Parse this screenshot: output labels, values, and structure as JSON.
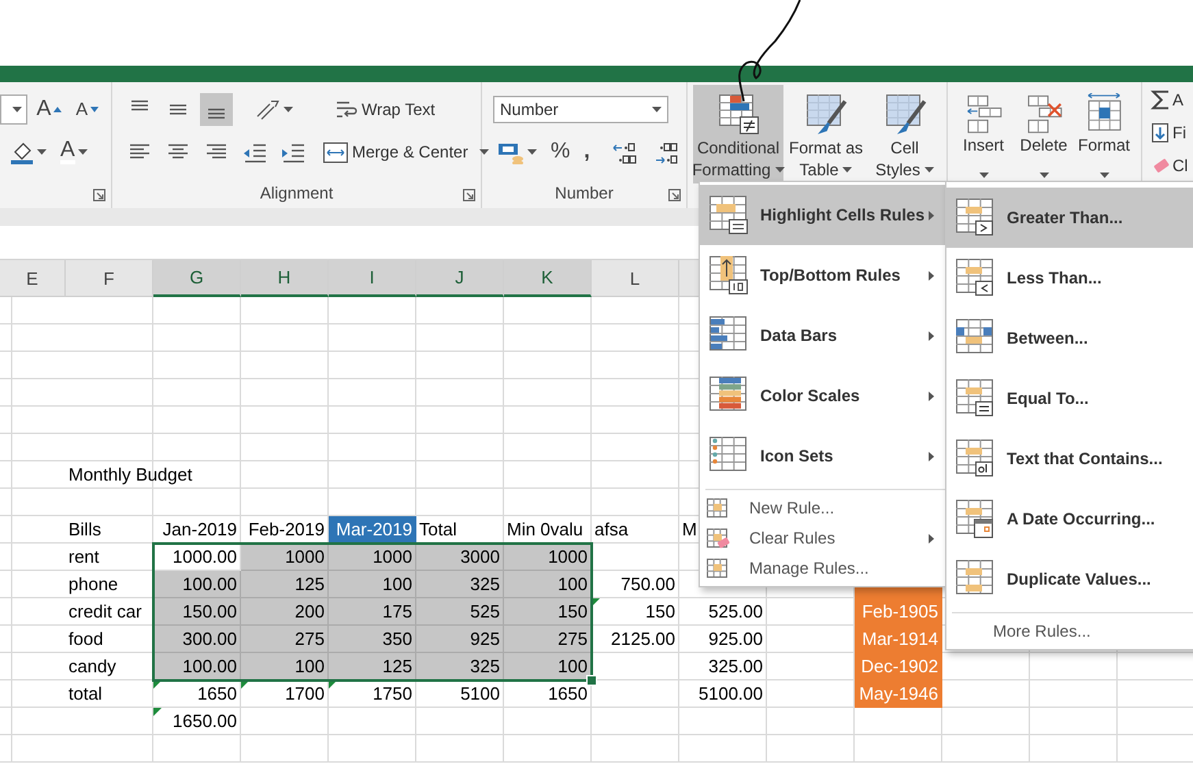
{
  "ribbon": {
    "font": {
      "grow_font": "A",
      "shrink_font": "A",
      "font_color": "A"
    },
    "alignment": {
      "label": "Alignment",
      "vertical": [
        {
          "selected": false
        },
        {
          "selected": false
        },
        {
          "selected": true
        }
      ],
      "wrap_text": "Wrap Text",
      "merge_center": "Merge & Center"
    },
    "number": {
      "label": "Number",
      "format": "Number",
      "percent": "%",
      "comma": ","
    },
    "styles": [
      {
        "lines": [
          "Conditional",
          "Formatting"
        ],
        "selected": true
      },
      {
        "lines": [
          "Format as",
          "Table"
        ],
        "selected": false
      },
      {
        "lines": [
          "Cell",
          "Styles"
        ],
        "selected": false
      }
    ],
    "cells": [
      {
        "label": "Insert"
      },
      {
        "label": "Delete"
      },
      {
        "label": "Format"
      }
    ],
    "editing": [
      {
        "label": "A"
      },
      {
        "label": "Fi"
      },
      {
        "label": "Cl"
      }
    ]
  },
  "sheet": {
    "columns": [
      {
        "label": "E",
        "selected": false
      },
      {
        "label": "F",
        "selected": false
      },
      {
        "label": "G",
        "selected": true
      },
      {
        "label": "H",
        "selected": true
      },
      {
        "label": "I",
        "selected": true
      },
      {
        "label": "J",
        "selected": true
      },
      {
        "label": "K",
        "selected": true
      },
      {
        "label": "L",
        "selected": false
      }
    ],
    "rows": [
      [
        null,
        null,
        null,
        null,
        null,
        null,
        null,
        null,
        null,
        null,
        null,
        null
      ],
      [
        null,
        null,
        null,
        null,
        null,
        null,
        null,
        null,
        null,
        null,
        null,
        null
      ],
      [
        null,
        null,
        null,
        null,
        null,
        null,
        null,
        null,
        null,
        null,
        null,
        null
      ],
      [
        null,
        null,
        null,
        null,
        null,
        null,
        null,
        null,
        null,
        null,
        null,
        null
      ],
      [
        null,
        null,
        null,
        null,
        null,
        null,
        null,
        null,
        null,
        null,
        null,
        null
      ],
      [
        null,
        null,
        null,
        null,
        null,
        null,
        null,
        null,
        null,
        null,
        null,
        null
      ],
      [
        null,
        {
          "text": "Monthly Budget",
          "kind": "label",
          "selected": false,
          "flagged": false
        },
        null,
        null,
        null,
        null,
        null,
        null,
        null,
        null,
        null,
        null
      ],
      [
        null,
        null,
        null,
        null,
        null,
        null,
        null,
        null,
        null,
        null,
        null,
        null
      ],
      [
        null,
        {
          "text": "Bills",
          "kind": "label",
          "selected": false,
          "flagged": false
        },
        {
          "text": "Jan-2019",
          "kind": "value",
          "selected": false,
          "flagged": false
        },
        {
          "text": "Feb-2019",
          "kind": "value",
          "selected": false,
          "flagged": false
        },
        {
          "text": "Mar-2019",
          "kind": "value",
          "selected": false,
          "flagged": false,
          "color": "#2e75b6"
        },
        {
          "text": "Total",
          "kind": "label",
          "selected": false,
          "flagged": false
        },
        {
          "text": "Min 0valu",
          "kind": "label",
          "selected": false,
          "flagged": false
        },
        {
          "text": "afsa",
          "kind": "label",
          "selected": false,
          "flagged": false
        },
        {
          "text": "M",
          "kind": "label",
          "selected": false,
          "flagged": false
        },
        null,
        null,
        null
      ],
      [
        null,
        {
          "text": "rent",
          "kind": "label",
          "selected": false,
          "flagged": false
        },
        {
          "text": "1000.00",
          "kind": "value",
          "selected": false,
          "flagged": false
        },
        {
          "text": "1000",
          "kind": "value",
          "selected": true,
          "flagged": false
        },
        {
          "text": "1000",
          "kind": "value",
          "selected": true,
          "flagged": false
        },
        {
          "text": "3000",
          "kind": "value",
          "selected": true,
          "flagged": false
        },
        {
          "text": "1000",
          "kind": "value",
          "selected": true,
          "flagged": false
        },
        null,
        null,
        null,
        null,
        null
      ],
      [
        null,
        {
          "text": "phone",
          "kind": "label",
          "selected": false,
          "flagged": false
        },
        {
          "text": "100.00",
          "kind": "value",
          "selected": true,
          "flagged": false
        },
        {
          "text": "125",
          "kind": "value",
          "selected": true,
          "flagged": false
        },
        {
          "text": "100",
          "kind": "value",
          "selected": true,
          "flagged": false
        },
        {
          "text": "325",
          "kind": "value",
          "selected": true,
          "flagged": false
        },
        {
          "text": "100",
          "kind": "value",
          "selected": true,
          "flagged": false
        },
        {
          "text": "750.00",
          "kind": "value",
          "selected": false,
          "flagged": false
        },
        null,
        null,
        {
          "kind": "value",
          "selected": false,
          "flagged": false,
          "color": "#ed7d31"
        },
        null
      ],
      [
        null,
        {
          "text": "credit car",
          "kind": "label",
          "selected": false,
          "flagged": false
        },
        {
          "text": "150.00",
          "kind": "value",
          "selected": true,
          "flagged": false
        },
        {
          "text": "200",
          "kind": "value",
          "selected": true,
          "flagged": false
        },
        {
          "text": "175",
          "kind": "value",
          "selected": true,
          "flagged": false
        },
        {
          "text": "525",
          "kind": "value",
          "selected": true,
          "flagged": false
        },
        {
          "text": "150",
          "kind": "value",
          "selected": true,
          "flagged": false
        },
        {
          "text": "150",
          "kind": "value",
          "selected": false,
          "flagged": true
        },
        {
          "text": "525.00",
          "kind": "value",
          "selected": false,
          "flagged": false
        },
        null,
        {
          "text": "Feb-1905",
          "kind": "value",
          "selected": false,
          "flagged": false,
          "color": "#ed7d31"
        },
        null
      ],
      [
        null,
        {
          "text": "food",
          "kind": "label",
          "selected": false,
          "flagged": false
        },
        {
          "text": "300.00",
          "kind": "value",
          "selected": true,
          "flagged": false
        },
        {
          "text": "275",
          "kind": "value",
          "selected": true,
          "flagged": false
        },
        {
          "text": "350",
          "kind": "value",
          "selected": true,
          "flagged": false
        },
        {
          "text": "925",
          "kind": "value",
          "selected": true,
          "flagged": false
        },
        {
          "text": "275",
          "kind": "value",
          "selected": true,
          "flagged": false
        },
        {
          "text": "2125.00",
          "kind": "value",
          "selected": false,
          "flagged": false
        },
        {
          "text": "925.00",
          "kind": "value",
          "selected": false,
          "flagged": false
        },
        null,
        {
          "text": "Mar-1914",
          "kind": "value",
          "selected": false,
          "flagged": false,
          "color": "#ed7d31"
        },
        null
      ],
      [
        null,
        {
          "text": "candy",
          "kind": "label",
          "selected": false,
          "flagged": false
        },
        {
          "text": "100.00",
          "kind": "value",
          "selected": true,
          "flagged": false
        },
        {
          "text": "100",
          "kind": "value",
          "selected": true,
          "flagged": false
        },
        {
          "text": "125",
          "kind": "value",
          "selected": true,
          "flagged": false
        },
        {
          "text": "325",
          "kind": "value",
          "selected": true,
          "flagged": false
        },
        {
          "text": "100",
          "kind": "value",
          "selected": true,
          "flagged": false
        },
        null,
        {
          "text": "325.00",
          "kind": "value",
          "selected": false,
          "flagged": false
        },
        null,
        {
          "text": "Dec-1902",
          "kind": "value",
          "selected": false,
          "flagged": false,
          "color": "#ed7d31"
        },
        null
      ],
      [
        null,
        {
          "text": "total",
          "kind": "label",
          "selected": false,
          "flagged": false
        },
        {
          "text": "1650",
          "kind": "value",
          "selected": false,
          "flagged": true
        },
        {
          "text": "1700",
          "kind": "value",
          "selected": false,
          "flagged": true
        },
        {
          "text": "1750",
          "kind": "value",
          "selected": false,
          "flagged": true
        },
        {
          "text": "5100",
          "kind": "value",
          "selected": false,
          "flagged": false
        },
        {
          "text": "1650",
          "kind": "value",
          "selected": false,
          "flagged": false
        },
        null,
        {
          "text": "5100.00",
          "kind": "value",
          "selected": false,
          "flagged": false
        },
        null,
        {
          "text": "May-1946",
          "kind": "value",
          "selected": false,
          "flagged": false,
          "color": "#ed7d31"
        },
        null
      ],
      [
        null,
        null,
        {
          "text": "1650.00",
          "kind": "value",
          "selected": false,
          "flagged": true
        },
        null,
        null,
        null,
        null,
        null,
        null,
        null,
        null,
        null
      ],
      [
        null,
        null,
        null,
        null,
        null,
        null,
        null,
        null,
        null,
        null,
        null,
        null
      ]
    ]
  },
  "menu": {
    "items": [
      {
        "label": "Highlight Cells Rules",
        "kind": "large",
        "selected": true,
        "has_submenu": true
      },
      {
        "label": "Top/Bottom Rules",
        "kind": "large",
        "selected": false,
        "has_submenu": true
      },
      {
        "label": "Data Bars",
        "kind": "large",
        "selected": false,
        "has_submenu": true
      },
      {
        "label": "Color Scales",
        "kind": "large",
        "selected": false,
        "has_submenu": true
      },
      {
        "label": "Icon Sets",
        "kind": "large",
        "selected": false,
        "has_submenu": true
      },
      {
        "label": "New Rule...",
        "kind": "small",
        "selected": false,
        "has_submenu": false
      },
      {
        "label": "Clear Rules",
        "kind": "small",
        "selected": false,
        "has_submenu": true
      },
      {
        "label": "Manage Rules...",
        "kind": "small",
        "selected": false,
        "has_submenu": false
      }
    ]
  },
  "submenu": {
    "items": [
      {
        "label": "Greater Than...",
        "kind": "large",
        "selected": true
      },
      {
        "label": "Less Than...",
        "kind": "large",
        "selected": false
      },
      {
        "label": "Between...",
        "kind": "large",
        "selected": false
      },
      {
        "label": "Equal To...",
        "kind": "large",
        "selected": false
      },
      {
        "label": "Text that Contains...",
        "kind": "large",
        "selected": false
      },
      {
        "label": "A Date Occurring...",
        "kind": "large",
        "selected": false
      },
      {
        "label": "Duplicate Values...",
        "kind": "large",
        "selected": false
      },
      {
        "label": "More Rules...",
        "kind": "small",
        "selected": false
      }
    ]
  }
}
